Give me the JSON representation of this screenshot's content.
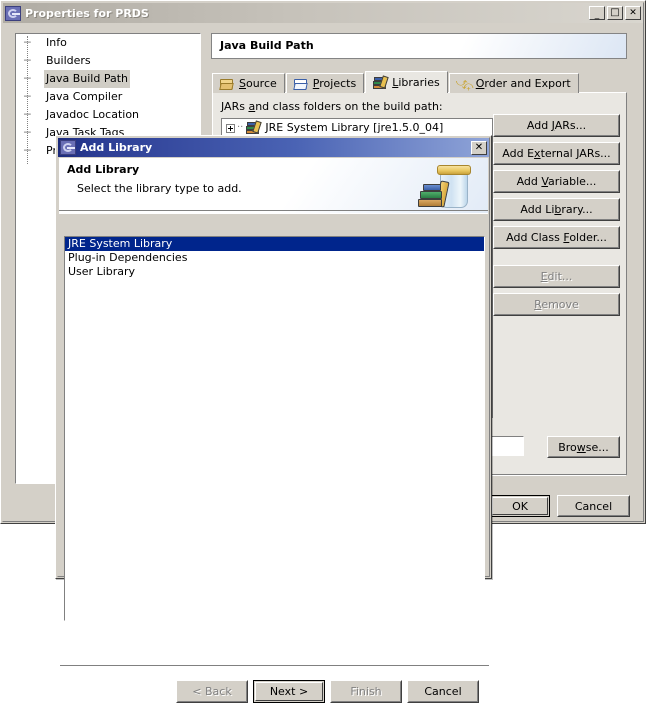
{
  "main_window": {
    "title": "Properties for PRDS",
    "icon": "eclipse-icon",
    "window_controls": {
      "minimize": "_",
      "maximize": "□",
      "close": "✕"
    },
    "tree": {
      "items": [
        {
          "label": "Info",
          "selected": false
        },
        {
          "label": "Builders",
          "selected": false
        },
        {
          "label": "Java Build Path",
          "selected": true
        },
        {
          "label": "Java Compiler",
          "selected": false
        },
        {
          "label": "Javadoc Location",
          "selected": false
        },
        {
          "label": "Java Task Tags",
          "selected": false
        },
        {
          "label": "Proj",
          "selected": false
        }
      ]
    },
    "page_title": "Java Build Path",
    "tabs": [
      {
        "label": "Source",
        "mnemonic": "S",
        "icon": "folder-open-icon",
        "active": false
      },
      {
        "label": "Projects",
        "mnemonic": "P",
        "icon": "folder-blue-icon",
        "active": false
      },
      {
        "label": "Libraries",
        "mnemonic": "L",
        "icon": "books-icon",
        "active": true
      },
      {
        "label": "Order and Export",
        "mnemonic": "O",
        "icon": "order-arrows-icon",
        "active": false
      }
    ],
    "libraries_tab": {
      "list_label": "JARs and class folders on the build path:",
      "list_label_mnemonic": "a",
      "entries": [
        {
          "label": "JRE System Library [jre1.5.0_04]",
          "icon": "books-icon",
          "expandable": true
        }
      ],
      "buttons": [
        {
          "label": "Add JARs...",
          "mnemonic": "J",
          "disabled": false
        },
        {
          "label": "Add External JARs...",
          "mnemonic": "x",
          "disabled": false
        },
        {
          "label": "Add Variable...",
          "mnemonic": "V",
          "disabled": false
        },
        {
          "label": "Add Library...",
          "mnemonic": "b",
          "disabled": false
        },
        {
          "label": "Add Class Folder...",
          "mnemonic": "F",
          "disabled": false
        },
        {
          "label": "Edit...",
          "mnemonic": "E",
          "disabled": true
        },
        {
          "label": "Remove",
          "mnemonic": "R",
          "disabled": true
        }
      ]
    },
    "path_field": {
      "value": "",
      "placeholder": ""
    },
    "browse_button": {
      "label": "Browse...",
      "mnemonic": "w"
    },
    "ok_button": {
      "label": "OK",
      "default": true
    },
    "cancel_button": {
      "label": "Cancel"
    }
  },
  "add_library_dialog": {
    "title": "Add Library",
    "icon": "eclipse-icon",
    "close_label": "✕",
    "heading": "Add Library",
    "description": "Select the library type to add.",
    "banner_icon": "jar-with-books-icon",
    "list": [
      {
        "label": "JRE System Library",
        "selected": true
      },
      {
        "label": "Plug-in Dependencies",
        "selected": false
      },
      {
        "label": "User Library",
        "selected": false
      }
    ],
    "buttons": [
      {
        "label": "< Back",
        "disabled": true,
        "default": false
      },
      {
        "label": "Next >",
        "disabled": false,
        "default": true
      },
      {
        "label": "Finish",
        "disabled": true,
        "default": false
      },
      {
        "label": "Cancel",
        "disabled": false,
        "default": false
      }
    ]
  },
  "colors": {
    "face": "#d4d0c8",
    "tab_active": "#e9e7e2",
    "selection_blue": "#00258c",
    "inactive_title": "#b0aca4",
    "active_title": "#1c2a7a",
    "tree_selection": "#d0cdc5"
  }
}
